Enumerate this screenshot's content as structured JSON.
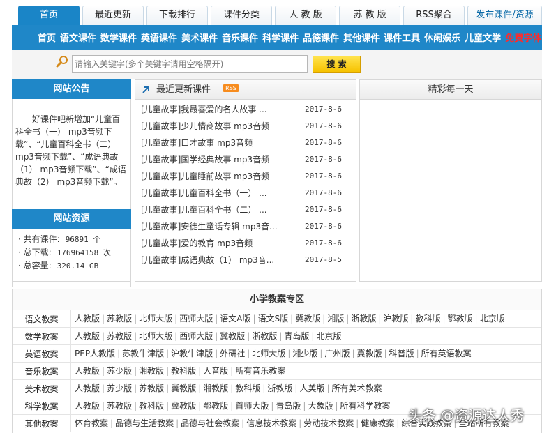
{
  "tabs": [
    "首页",
    "最近更新",
    "下载排行",
    "课件分类",
    "人 教 版",
    "苏 教 版",
    "RSS聚合",
    "发布课件/资源"
  ],
  "nav": [
    "首页",
    "语文课件",
    "数学课件",
    "英语课件",
    "美术课件",
    "音乐课件",
    "科学课件",
    "品德课件",
    "其他课件",
    "课件工具",
    "休闲娱乐",
    "儿童文学",
    "免费字体"
  ],
  "search": {
    "placeholder": "请输入关键字(多个关键字请用空格隔开)",
    "button": "搜 索"
  },
  "notice": {
    "title": "网站公告",
    "text": "好课件吧新增加“儿童百科全书（一） mp3音频下载”、“儿童百科全书（二） mp3音频下载”、“成语典故（1） mp3音频下载”、“成语典故（2） mp3音频下载”。"
  },
  "stats": {
    "title": "网站资源",
    "rows": [
      {
        "label": "· 共有课件:",
        "value": "96891 个"
      },
      {
        "label": "· 总下载:",
        "value": "176964158 次"
      },
      {
        "label": "· 总容量:",
        "value": "320.14 GB"
      }
    ]
  },
  "latest": {
    "title": "最近更新课件",
    "rss": "RSS",
    "items": [
      {
        "title": "[儿童故事]我最喜爱的名人故事 ...",
        "date": "2017-8-6"
      },
      {
        "title": "[儿童故事]少儿情商故事 mp3音频",
        "date": "2017-8-6"
      },
      {
        "title": "[儿童故事]口才故事 mp3音频",
        "date": "2017-8-6"
      },
      {
        "title": "[儿童故事]国学经典故事 mp3音频",
        "date": "2017-8-6"
      },
      {
        "title": "[儿童故事]儿童睡前故事 mp3音频",
        "date": "2017-8-6"
      },
      {
        "title": "[儿童故事]儿童百科全书（一） ...",
        "date": "2017-8-6"
      },
      {
        "title": "[儿童故事]儿童百科全书（二） ...",
        "date": "2017-8-6"
      },
      {
        "title": "[儿童故事]安徒生童话专辑 mp3音...",
        "date": "2017-8-6"
      },
      {
        "title": "[儿童故事]爱的教育 mp3音频",
        "date": "2017-8-6"
      },
      {
        "title": "[儿童故事]成语典故（1） mp3音...",
        "date": "2017-8-5"
      }
    ]
  },
  "daily": {
    "title": "精彩每一天"
  },
  "zone": {
    "title": "小学教案专区",
    "rows": [
      {
        "label": "语文教案",
        "links": [
          "人教版",
          "苏教版",
          "北师大版",
          "西师大版",
          "语文A版",
          "语文S版",
          "冀教版",
          "湘版",
          "浙教版",
          "沪教版",
          "教科版",
          "鄂教版",
          "北京版"
        ]
      },
      {
        "label": "数学教案",
        "links": [
          "人教版",
          "苏教版",
          "北师大版",
          "西师大版",
          "冀教版",
          "浙教版",
          "青岛版",
          "北京版"
        ]
      },
      {
        "label": "英语教案",
        "links": [
          "PEP人教版",
          "苏教牛津版",
          "沪教牛津版",
          "外研社",
          "北师大版",
          "湘少版",
          "广州版",
          "冀教版",
          "科普版",
          "所有英语教案"
        ]
      },
      {
        "label": "音乐教案",
        "links": [
          "人教版",
          "苏少版",
          "湘教版",
          "教科版",
          "人音版",
          "所有音乐教案"
        ]
      },
      {
        "label": "美术教案",
        "links": [
          "人教版",
          "苏少版",
          "苏教版",
          "冀教版",
          "湘教版",
          "教科版",
          "浙教版",
          "人美版",
          "所有美术教案"
        ]
      },
      {
        "label": "科学教案",
        "links": [
          "人教版",
          "苏教版",
          "教科版",
          "冀教版",
          "鄂教版",
          "首师大版",
          "青岛版",
          "大象版",
          "所有科学教案"
        ]
      },
      {
        "label": "其他教案",
        "links": [
          "体育教案",
          "品德与生活教案",
          "品德与社会教案",
          "信息技术教案",
          "劳动技术教案",
          "健康教案",
          "综合实践教案",
          "全站所有教案"
        ]
      }
    ]
  },
  "watermark": "头条 @资源达人秀",
  "colors": {
    "brand": "#1f87c8",
    "hot": "#ff2a2a",
    "search_button": "#f6c200"
  }
}
